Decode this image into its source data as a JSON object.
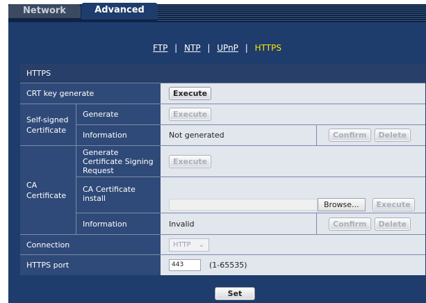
{
  "tabs": {
    "network": "Network",
    "advanced": "Advanced"
  },
  "subnav": {
    "ftp": "FTP",
    "ntp": "NTP",
    "upnp": "UPnP",
    "https": "HTTPS",
    "sep": "|"
  },
  "section_title": "HTTPS",
  "crt": {
    "label": "CRT key generate",
    "button": "Execute"
  },
  "self_signed": {
    "group_label": "Self-signed Certificate",
    "generate_label": "Generate",
    "generate_button": "Execute",
    "info_label": "Information",
    "info_value": "Not generated",
    "confirm_button": "Confirm",
    "delete_button": "Delete"
  },
  "ca": {
    "group_label": "CA Certificate",
    "csr_label": "Generate Certificate Signing Request",
    "csr_button": "Execute",
    "install_label": "CA Certificate install",
    "browse_button": "Browse...",
    "install_button": "Execute",
    "info_label": "Information",
    "info_value": "Invalid",
    "confirm_button": "Confirm",
    "delete_button": "Delete"
  },
  "connection": {
    "label": "Connection",
    "value": "HTTP",
    "options": [
      "HTTP"
    ]
  },
  "port": {
    "label": "HTTPS port",
    "value": "443",
    "range": "(1-65535)"
  },
  "set_button": "Set"
}
